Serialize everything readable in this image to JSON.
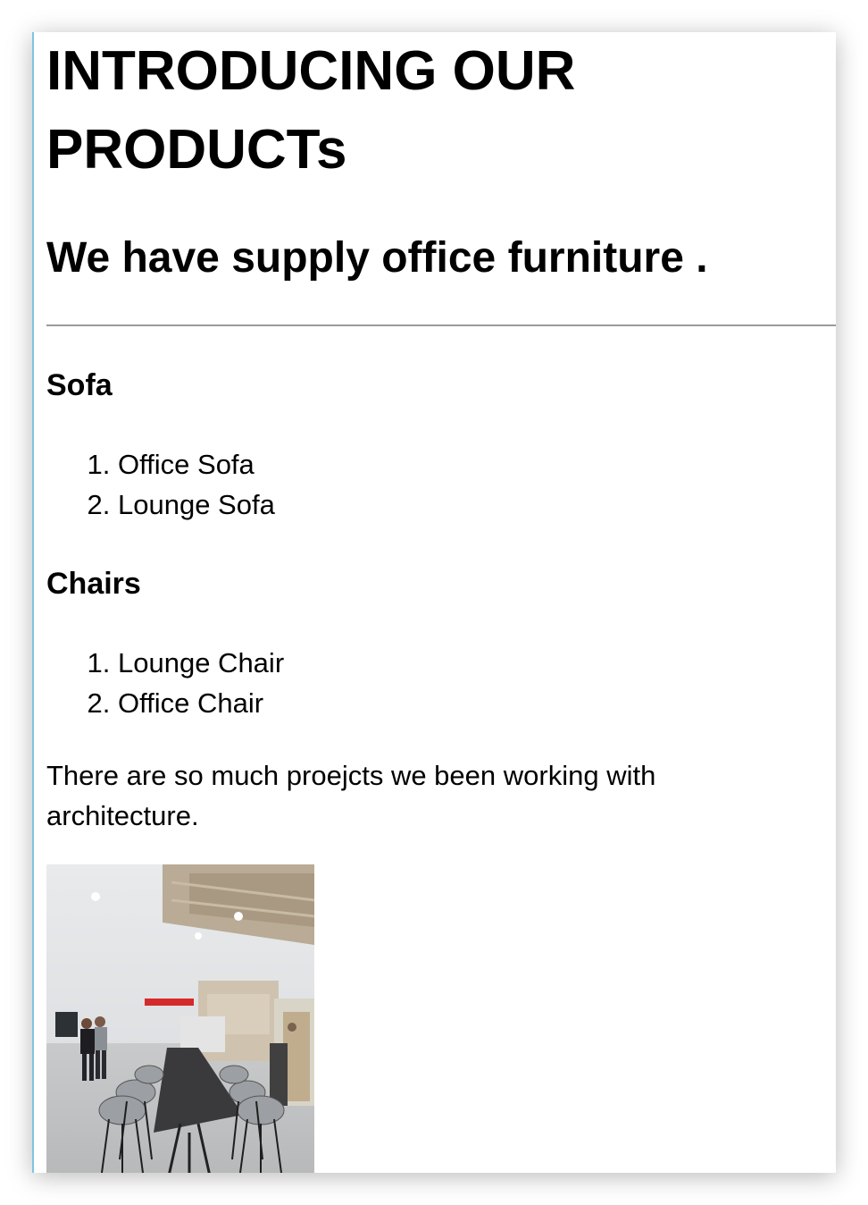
{
  "page": {
    "title": "INTRODUCING OUR PRODUCTs",
    "subtitle": "We have supply office furniture .",
    "sections": [
      {
        "heading": "Sofa",
        "items": [
          "Office Sofa",
          "Lounge Sofa"
        ]
      },
      {
        "heading": "Chairs",
        "items": [
          "Lounge Chair",
          "Office Chair"
        ]
      }
    ],
    "paragraph": "There are so much proejcts we been working with architecture.",
    "photo": {
      "alt": "office-interior-photo"
    },
    "colors": {
      "accent_border": "#7fc4e0",
      "rule": "#9a9a9a"
    }
  }
}
